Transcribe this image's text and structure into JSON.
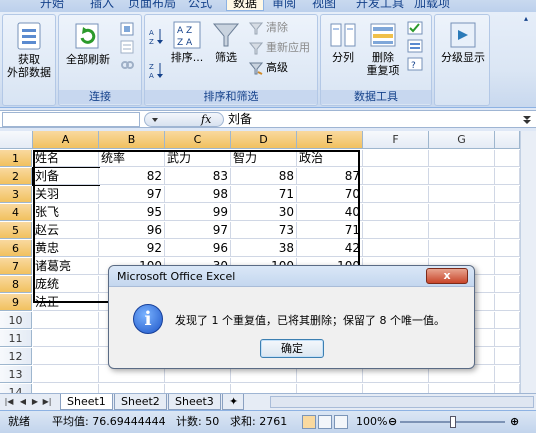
{
  "ribbon_tabs": [
    {
      "label": "开始"
    },
    {
      "label": "插入"
    },
    {
      "label": "页面布局"
    },
    {
      "label": "公式"
    },
    {
      "label": "数据",
      "active": true
    },
    {
      "label": "审阅"
    },
    {
      "label": "视图"
    },
    {
      "label": "开发工具"
    },
    {
      "label": "加载项"
    }
  ],
  "groups": {
    "get_external": {
      "label": "获取\n外部数据",
      "line1": "获取",
      "line2": "外部数据"
    },
    "connections": {
      "title": "连接",
      "refresh_all": "全部刷新"
    },
    "sort_filter": {
      "title": "排序和筛选",
      "sort": "排序...",
      "filter": "筛选",
      "clear": "清除",
      "reapply": "重新应用",
      "advanced": "高级"
    },
    "data_tools": {
      "title": "数据工具",
      "split": "分列",
      "remove_dup_line1": "删除",
      "remove_dup_line2": "重复项"
    },
    "outline": {
      "label": "分级显示"
    }
  },
  "formula_bar": {
    "namebox": "",
    "fx": "fx",
    "value": "刘备"
  },
  "columns": [
    "A",
    "B",
    "C",
    "D",
    "E",
    "F",
    "G"
  ],
  "rows": [
    {
      "n": "1",
      "cells": [
        "姓名",
        "统率",
        "武力",
        "智力",
        "政治"
      ]
    },
    {
      "n": "2",
      "cells": [
        "刘备",
        "82",
        "83",
        "88",
        "87"
      ]
    },
    {
      "n": "3",
      "cells": [
        "关羽",
        "97",
        "98",
        "71",
        "70"
      ]
    },
    {
      "n": "4",
      "cells": [
        "张飞",
        "95",
        "99",
        "30",
        "40"
      ]
    },
    {
      "n": "5",
      "cells": [
        "赵云",
        "96",
        "97",
        "73",
        "71"
      ]
    },
    {
      "n": "6",
      "cells": [
        "黄忠",
        "92",
        "96",
        "38",
        "42"
      ]
    },
    {
      "n": "7",
      "cells": [
        "诸葛亮",
        "100",
        "30",
        "100",
        "100"
      ]
    },
    {
      "n": "8",
      "cells": [
        "庞统",
        "",
        "",
        "",
        ""
      ]
    },
    {
      "n": "9",
      "cells": [
        "法正",
        "",
        "",
        "",
        ""
      ]
    },
    {
      "n": "10",
      "cells": [
        "",
        "",
        "",
        "",
        ""
      ]
    },
    {
      "n": "11",
      "cells": [
        "",
        "",
        "",
        "",
        ""
      ]
    },
    {
      "n": "12",
      "cells": [
        "",
        "",
        "",
        "",
        ""
      ]
    },
    {
      "n": "13",
      "cells": [
        "",
        "",
        "",
        "",
        ""
      ]
    },
    {
      "n": "14",
      "cells": [
        "",
        "",
        "",
        "",
        ""
      ]
    }
  ],
  "dialog": {
    "title": "Microsoft Office Excel",
    "message": "发现了 1 个重复值，已将其删除；保留了 8 个唯一值。",
    "ok": "确定",
    "close": "x"
  },
  "sheets": [
    "Sheet1",
    "Sheet2",
    "Sheet3"
  ],
  "status": {
    "ready": "就绪",
    "average": "平均值: 76.69444444",
    "count": "计数: 50",
    "sum": "求和: 2761",
    "zoom": "100%"
  },
  "colors": {
    "accent": "#15428b",
    "selected_header": "#f1c15f"
  }
}
